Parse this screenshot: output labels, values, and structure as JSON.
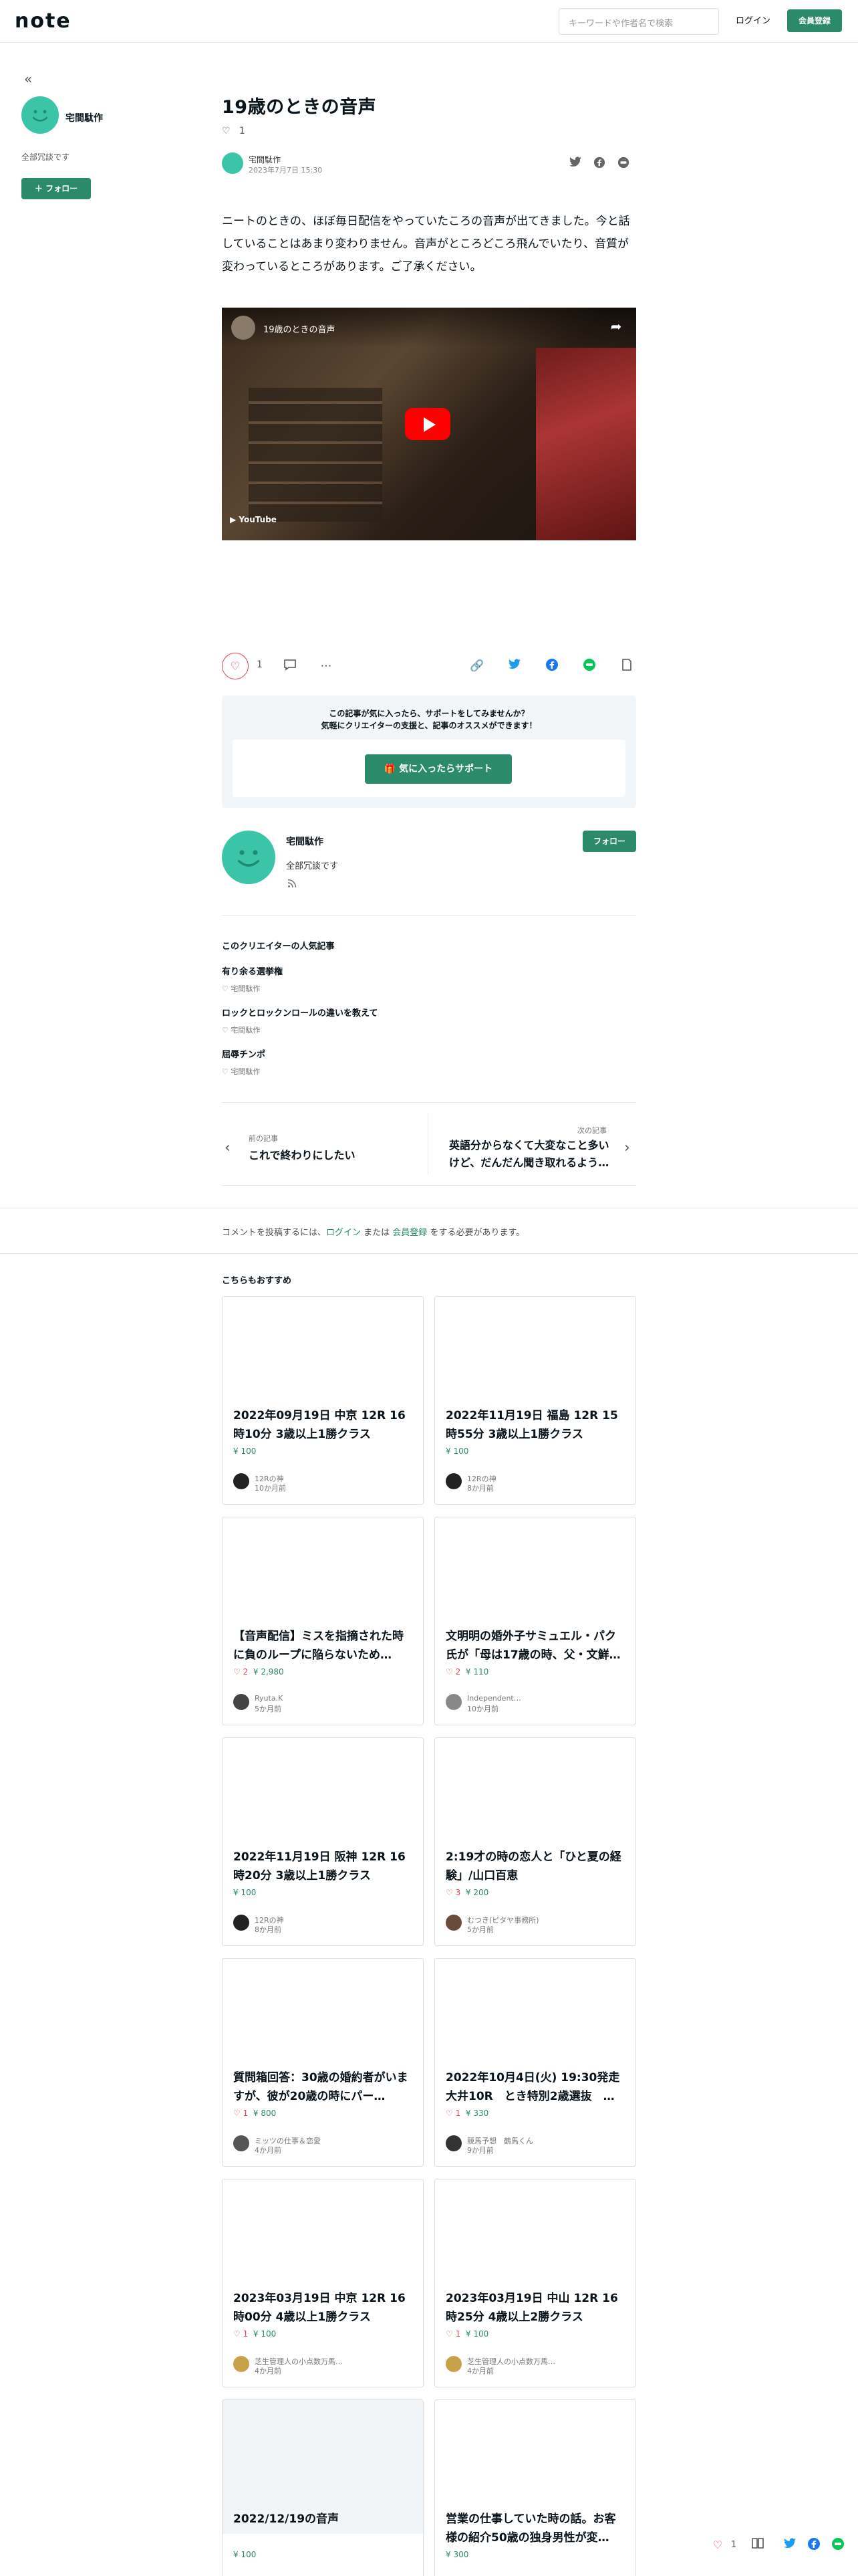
{
  "header": {
    "logo": "note",
    "search_placeholder": "キーワードや作者名で検索",
    "login": "ログイン",
    "signup": "会員登録"
  },
  "sidebar": {
    "back_icon": "double-chevron-left-icon",
    "creator_name": "宅間駄作",
    "bio": "全部冗談です",
    "follow": "フォロー"
  },
  "article": {
    "title": "19歳のときの音声",
    "like_count": "1",
    "author": "宅間駄作",
    "date": "2023年7月7日 15:30",
    "body": "ニートのときの、ほぼ毎日配信をやっていたころの音声が出てきました。今と話していることはあまり変わりません。音声がところどころ飛んでいたり、音質が変わっているところがあります。ご了承ください。",
    "video": {
      "title": "19歳のときの音声",
      "brand": "YouTube"
    }
  },
  "actions": {
    "like_count": "1"
  },
  "support": {
    "line1": "この記事が気に入ったら、サポートをしてみませんか？",
    "line2": "気軽にクリエイターの支援と、記事のオススメができます！",
    "button": "気に入ったらサポート"
  },
  "creator": {
    "name": "宅間駄作",
    "bio": "全部冗談です",
    "follow": "フォロー"
  },
  "popular": {
    "heading": "このクリエイターの人気記事",
    "items": [
      {
        "title": "有り余る選挙権",
        "author": "宅間駄作"
      },
      {
        "title": "ロックとロックンロールの違いを教えて",
        "author": "宅間駄作"
      },
      {
        "title": "屈辱チンポ",
        "author": "宅間駄作"
      }
    ]
  },
  "nav": {
    "prev_label": "前の記事",
    "prev_title": "これで終わりにしたい",
    "next_label": "次の記事",
    "next_title": "英語分からなくて大変なこと多いけど、だんだん聞き取れるよう…"
  },
  "comment": {
    "pre": "コメントを投稿するには、",
    "login": "ログイン",
    "mid": " または ",
    "signup": "会員登録",
    "post": " をする必要があります。"
  },
  "recommend": {
    "heading": "こちらもおすすめ",
    "cards": [
      {
        "title": "2022年09月19日 中京 12R 16時10分 3歳以上1勝クラス",
        "likes": "",
        "price": "100",
        "author": "12Rの神",
        "time": "10か月前"
      },
      {
        "title": "2022年11月19日 福島 12R 15時55分 3歳以上1勝クラス",
        "likes": "",
        "price": "100",
        "author": "12Rの神",
        "time": "8か月前"
      },
      {
        "title": "【音声配信】ミスを指摘された時に負のループに陥らないため…",
        "likes": "2",
        "price": "2,980",
        "author": "Ryuta.K",
        "time": "5か月前"
      },
      {
        "title": "文明明の婚外子サミュエル・パク氏が「母は17歳の時、父・文鮮…",
        "likes": "2",
        "price": "110",
        "author": "Independent…",
        "time": "10か月前"
      },
      {
        "title": "2022年11月19日 阪神 12R 16時20分 3歳以上1勝クラス",
        "likes": "",
        "price": "100",
        "author": "12Rの神",
        "time": "8か月前"
      },
      {
        "title": "2:19才の時の恋人と「ひと夏の経験」/山口百恵",
        "likes": "3",
        "price": "200",
        "author": "むつき(ピタヤ事務所)",
        "time": "5か月前"
      },
      {
        "title": "質問箱回答：30歳の婚約者がいますが、彼が20歳の時にパー…",
        "likes": "1",
        "price": "800",
        "author": "ミッツの仕事＆恋愛",
        "time": "4か月前"
      },
      {
        "title": "2022年10月4日(火) 19:30発走 大井10R　とき特別2歳選抜　…",
        "likes": "1",
        "price": "330",
        "author": "競馬予想　鶴馬くん",
        "time": "9か月前"
      },
      {
        "title": "2023年03月19日 中京 12R 16時00分 4歳以上1勝クラス",
        "likes": "1",
        "price": "100",
        "author": "芝生管理人の小点数万馬…",
        "time": "4か月前"
      },
      {
        "title": "2023年03月19日 中山 12R 16時25分 4歳以上2勝クラス",
        "likes": "1",
        "price": "100",
        "author": "芝生管理人の小点数万馬…",
        "time": "4か月前"
      },
      {
        "title": "2022/12/19の音声",
        "likes": "",
        "price": "100",
        "author": "",
        "time": ""
      },
      {
        "title": "営業の仕事していた時の話。お客様の紹介50歳の独身男性が変…",
        "likes": "",
        "price": "300",
        "author": "",
        "time": ""
      }
    ]
  },
  "float_bar": {
    "like_count": "1"
  },
  "colors": {
    "brand_green": "#2a8a6a",
    "avatar_teal": "#3cc4a8",
    "like_red": "#e4445a"
  }
}
